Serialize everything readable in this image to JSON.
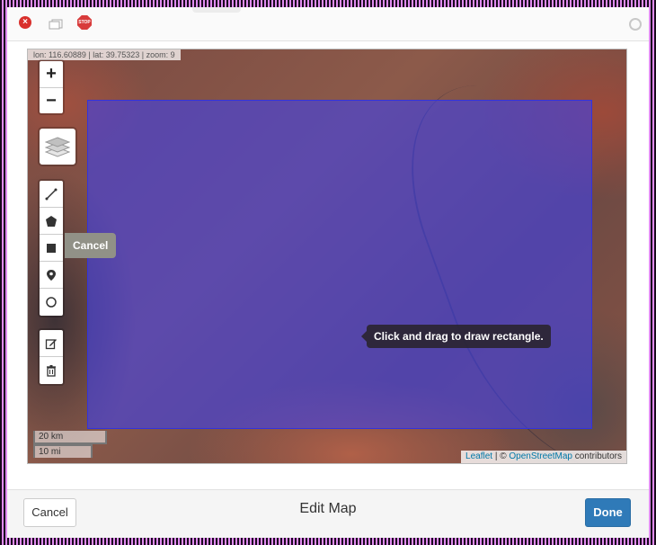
{
  "map": {
    "coords_text": "lon: 116.60889 | lat: 39.75323 | zoom: 9",
    "zoom_in_label": "+",
    "zoom_out_label": "−",
    "draw_cancel_label": "Cancel",
    "draw_tooltip": "Click and drag to draw rectangle.",
    "scale_km": "20 km",
    "scale_mi": "10 mi",
    "attribution": {
      "leaflet": "Leaflet",
      "separator": " | © ",
      "osm": "OpenStreetMap",
      "suffix": " contributors"
    },
    "draw_tools": [
      "polyline-icon",
      "polygon-icon",
      "rectangle-icon",
      "marker-icon",
      "circle-icon"
    ],
    "edit_tools": [
      "edit-icon",
      "trash-icon"
    ],
    "rectangle_color": "#4040e6"
  },
  "footer": {
    "cancel_label": "Cancel",
    "title": "Edit Map",
    "done_label": "Done",
    "done_color": "#2f7ab8"
  }
}
